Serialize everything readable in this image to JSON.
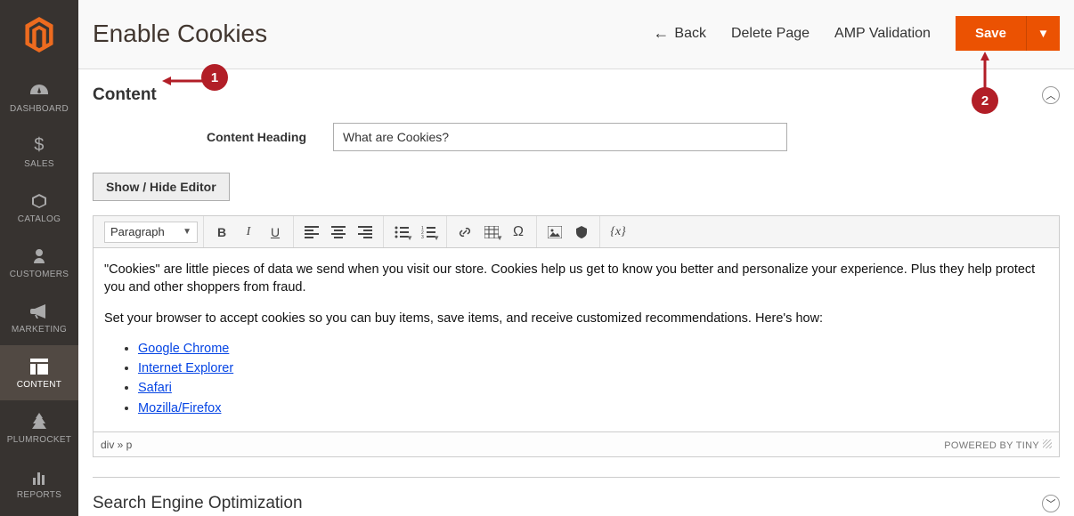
{
  "sidebar": {
    "items": [
      {
        "label": "DASHBOARD",
        "icon": "dashboard-icon"
      },
      {
        "label": "SALES",
        "icon": "dollar-icon"
      },
      {
        "label": "CATALOG",
        "icon": "box-icon"
      },
      {
        "label": "CUSTOMERS",
        "icon": "person-icon"
      },
      {
        "label": "MARKETING",
        "icon": "megaphone-icon"
      },
      {
        "label": "CONTENT",
        "icon": "layout-icon"
      },
      {
        "label": "PLUMROCKET",
        "icon": "tree-icon"
      },
      {
        "label": "REPORTS",
        "icon": "bars-icon"
      }
    ]
  },
  "header": {
    "title": "Enable Cookies",
    "back": "Back",
    "delete": "Delete Page",
    "amp": "AMP Validation",
    "save": "Save"
  },
  "section": {
    "title": "Content",
    "collapse": "︿"
  },
  "field": {
    "heading_label": "Content Heading",
    "heading_value": "What are Cookies?"
  },
  "editor": {
    "toggle": "Show / Hide Editor",
    "format": "Paragraph",
    "para1": "\"Cookies\" are little pieces of data we send when you visit our store. Cookies help us get to know you better and personalize your experience. Plus they help protect you and other shoppers from fraud.",
    "para2": "Set your browser to accept cookies so you can buy items, save items, and receive customized recommendations. Here's how:",
    "links": [
      "Google Chrome",
      "Internet Explorer",
      "Safari",
      "Mozilla/Firefox"
    ],
    "path": "div » p",
    "powered": "POWERED BY TINY"
  },
  "seo": {
    "title": "Search Engine Optimization"
  },
  "callouts": {
    "one": "1",
    "two": "2"
  }
}
